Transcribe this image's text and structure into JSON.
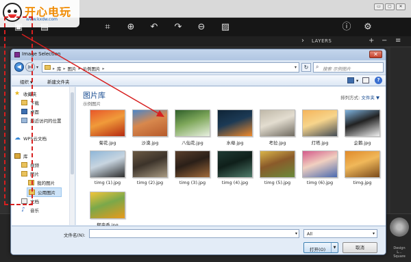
{
  "app": {
    "layers_label": "LAYERS",
    "layers_controls": [
      "+",
      "−",
      "≡"
    ],
    "design_label": "Design L... Square",
    "window_buttons": [
      "▭",
      "▢",
      "✕"
    ]
  },
  "watermark": {
    "text": "开心电玩",
    "url": "www.kxdw.com"
  },
  "dialog": {
    "title": "Image Selection",
    "close_glyph": "✕",
    "breadcrumbs": [
      "库",
      "图片",
      "示例图片"
    ],
    "search_placeholder": "搜索 示例图片",
    "toolbar": {
      "organize": "组织",
      "new_folder": "新建文件夹"
    },
    "nav": [
      {
        "label": "收藏夹",
        "icon": "star-icon"
      },
      {
        "label": "下载",
        "icon": "folder-icon"
      },
      {
        "label": "桌面",
        "icon": "desktop-icon"
      },
      {
        "label": "最近访问的位置",
        "icon": "recent-places-icon"
      },
      {
        "label": "WPS云文档",
        "icon": "cloud-icon"
      },
      {
        "label": "库",
        "icon": "library-icon"
      },
      {
        "label": "视频",
        "icon": "folder-icon"
      },
      {
        "label": "图片",
        "icon": "folder-icon"
      },
      {
        "label": "我的图片",
        "icon": "folder-icon"
      },
      {
        "label": "公用图片",
        "icon": "folder-icon"
      },
      {
        "label": "文档",
        "icon": "document-icon"
      },
      {
        "label": "音乐",
        "icon": "music-icon"
      }
    ],
    "library": {
      "title": "图片库",
      "subtitle": "示例图片",
      "arrange_label": "排列方式:",
      "arrange_value": "文件夹 ▼"
    },
    "files": [
      {
        "name": "菊花.jpg",
        "colors": [
          "#e8572a",
          "#b52a10",
          "#f09b3a"
        ]
      },
      {
        "name": "沙漠.jpg",
        "colors": [
          "#4a86c9",
          "#b65a2b",
          "#d8884d"
        ]
      },
      {
        "name": "八仙花.jpg",
        "colors": [
          "#2f5f2a",
          "#e8f0e0",
          "#7fa85b"
        ]
      },
      {
        "name": "水母.jpg",
        "colors": [
          "#0f2436",
          "#f08a2a",
          "#1c3a55"
        ]
      },
      {
        "name": "考拉.jpg",
        "colors": [
          "#bfb8a8",
          "#6f6a60",
          "#e3ddd0"
        ]
      },
      {
        "name": "灯塔.jpg",
        "colors": [
          "#f5b45a",
          "#444c55",
          "#f7d58c"
        ]
      },
      {
        "name": "企鹅.jpg",
        "colors": [
          "#7fb4e0",
          "#f0f0f0",
          "#222222"
        ]
      },
      {
        "name": "timg (1).jpg",
        "colors": [
          "#8eb6d8",
          "#2d2d2d",
          "#c8d5e0"
        ]
      },
      {
        "name": "timg (2).jpg",
        "colors": [
          "#6b5a44",
          "#a89a82",
          "#3c332a"
        ]
      },
      {
        "name": "timg (3).jpg",
        "colors": [
          "#5a3f2c",
          "#a06a3a",
          "#2a1f18"
        ]
      },
      {
        "name": "timg (4).jpg",
        "colors": [
          "#1f3a33",
          "#4e7a6a",
          "#0f1f1a"
        ]
      },
      {
        "name": "timg (5).jpg",
        "colors": [
          "#d9b44a",
          "#6a8a3a",
          "#8a5a2a"
        ]
      },
      {
        "name": "timg (6).jpg",
        "colors": [
          "#d45a8a",
          "#4a6ab0",
          "#f0d0c0"
        ]
      },
      {
        "name": "timg.jpg",
        "colors": [
          "#e08a2a",
          "#7a4a1a",
          "#f0b85a"
        ]
      },
      {
        "name": "郁金香.jpg",
        "colors": [
          "#f2c53a",
          "#e89a1a",
          "#7aa84a"
        ]
      }
    ],
    "footer": {
      "filename_label": "文件名(N):",
      "filename_value": "",
      "filter_value": "All",
      "open_label": "打开(O)",
      "cancel_label": "取消"
    }
  },
  "colors": {
    "annotation_red": "#d71f1f",
    "accent_blue": "#1b4e92"
  }
}
